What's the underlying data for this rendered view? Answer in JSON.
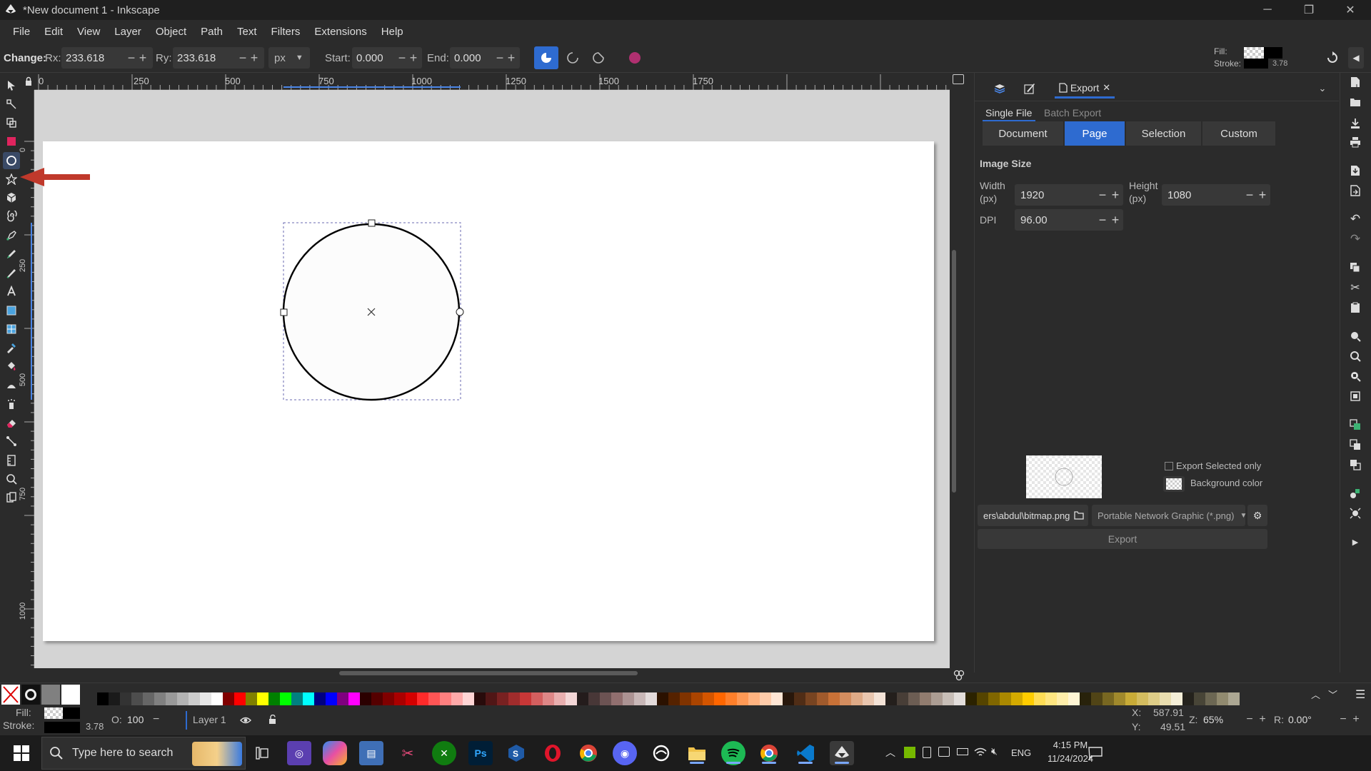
{
  "window": {
    "title": "*New document 1 - Inkscape",
    "controls": [
      "─",
      "❐",
      "✕"
    ]
  },
  "menu": [
    "File",
    "Edit",
    "View",
    "Layer",
    "Object",
    "Path",
    "Text",
    "Filters",
    "Extensions",
    "Help"
  ],
  "tool_controls": {
    "change_label": "Change:",
    "rx_label": "Rx:",
    "rx_value": "233.618",
    "ry_label": "Ry:",
    "ry_value": "233.618",
    "unit": "px",
    "start_label": "Start:",
    "start_value": "0.000",
    "end_label": "End:",
    "end_value": "0.000",
    "fill_label": "Fill:",
    "stroke_label": "Stroke:",
    "stroke_width": "3.78"
  },
  "ruler": {
    "h_labels": [
      "0",
      "250",
      "500",
      "750",
      "1000",
      "1250",
      "1500",
      "1750"
    ],
    "v_labels": [
      "0",
      "250",
      "500",
      "750",
      "1000"
    ]
  },
  "dialog": {
    "tab_export_label": "Export",
    "subtabs": [
      "Single File",
      "Batch Export"
    ],
    "modes": [
      "Document",
      "Page",
      "Selection",
      "Custom"
    ],
    "active_mode": "Page",
    "image_size_heading": "Image Size",
    "width_label": "Width",
    "width_unit": "(px)",
    "width_value": "1920",
    "height_label": "Height",
    "height_unit": "(px)",
    "height_value": "1080",
    "dpi_label": "DPI",
    "dpi_value": "96.00",
    "export_selected_only": "Export Selected only",
    "background_color": "Background color",
    "filename": "ers\\abdul\\bitmap.png",
    "format": "Portable Network Graphic (*.png)",
    "export_button": "Export"
  },
  "status": {
    "fill_label": "Fill:",
    "stroke_label": "Stroke:",
    "stroke_width": "3.78",
    "opacity_label": "O:",
    "opacity_value": "100",
    "layer": "Layer 1",
    "x_label": "X:",
    "x_value": "587.91",
    "y_label": "Y:",
    "y_value": "49.51",
    "zoom_label": "Z:",
    "zoom_value": "65%",
    "rotation_label": "R:",
    "rotation_value": "0.00°"
  },
  "taskbar": {
    "search_placeholder": "Type here to search",
    "language": "ENG",
    "time": "4:15 PM",
    "date": "11/24/2024"
  },
  "colors": {
    "accent_blue": "#2e6bd0",
    "arrow_red": "#c0392b",
    "palette": [
      "#000000",
      "#1a1a1a",
      "#333333",
      "#4d4d4d",
      "#666666",
      "#808080",
      "#999999",
      "#b3b3b3",
      "#cccccc",
      "#e6e6e6",
      "#ffffff",
      "#800000",
      "#ff0000",
      "#808000",
      "#ffff00",
      "#008000",
      "#00ff00",
      "#008080",
      "#00ffff",
      "#000080",
      "#0000ff",
      "#800080",
      "#ff00ff",
      "#2b0000",
      "#550000",
      "#800000",
      "#aa0000",
      "#d40000",
      "#ff2a2a",
      "#ff5555",
      "#ff8080",
      "#ffaaaa",
      "#ffd5d5",
      "#280b0b",
      "#501616",
      "#782121",
      "#a02c2c",
      "#c83737",
      "#d35f5f",
      "#de8787",
      "#e9afaf",
      "#f4d7d7",
      "#241c1c",
      "#483737",
      "#6c5353",
      "#916f6f",
      "#ac9393",
      "#c8b7b7",
      "#e3dbdb",
      "#2b1100",
      "#552200",
      "#803300",
      "#aa4400",
      "#d45500",
      "#ff6600",
      "#ff7f2a",
      "#ff9955",
      "#ffb380",
      "#ffccaa",
      "#ffe6d5",
      "#28170b",
      "#502d16",
      "#784421",
      "#a05a2c",
      "#c87137",
      "#d38d5f",
      "#deaa87",
      "#e9c6af",
      "#f4e3d7",
      "#241f1c",
      "#483e37",
      "#6c5d53",
      "#917c6f",
      "#ac9d93",
      "#c8beb7",
      "#e3dedb",
      "#2b2200",
      "#554400",
      "#806600",
      "#aa8800",
      "#d4aa00",
      "#ffcc00",
      "#ffdd55",
      "#ffe680",
      "#ffeeaa",
      "#fff6d5",
      "#28220b",
      "#504416",
      "#786721",
      "#a0892c",
      "#c8ab37",
      "#d3bc5f",
      "#decd87",
      "#e9ddaf",
      "#f4eed7",
      "#24221c",
      "#484537",
      "#6c6753",
      "#918a6f",
      "#aca793"
    ]
  }
}
